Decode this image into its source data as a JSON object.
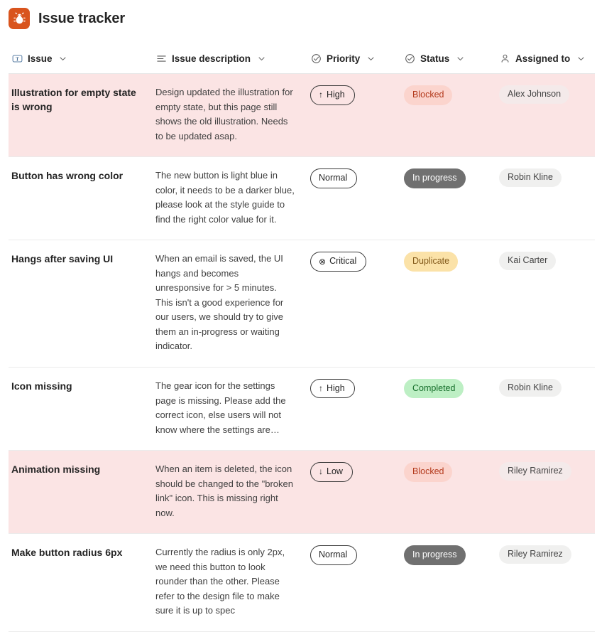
{
  "app": {
    "title": "Issue tracker",
    "logo_icon": "bug-icon",
    "logo_color": "#d9541d"
  },
  "table": {
    "columns": [
      {
        "key": "issue",
        "label": "Issue",
        "icon": "text-field-icon",
        "caret": "chevron-down-icon"
      },
      {
        "key": "description",
        "label": "Issue description",
        "icon": "multiline-text-icon",
        "caret": "chevron-down-icon"
      },
      {
        "key": "priority",
        "label": "Priority",
        "icon": "circle-check-icon",
        "caret": "chevron-down-icon"
      },
      {
        "key": "status",
        "label": "Status",
        "icon": "circle-check-icon",
        "caret": "chevron-down-icon"
      },
      {
        "key": "assigned",
        "label": "Assigned to",
        "icon": "person-icon",
        "caret": "chevron-down-icon"
      }
    ],
    "rows": [
      {
        "title": "Illustration for empty state is wrong",
        "description": "Design updated the illustration for empty state, but this page still shows the old illustration. Needs to be updated asap.",
        "priority": "High",
        "priority_icon": "↑",
        "status": "Blocked",
        "status_style": "s-blocked",
        "assigned": "Alex Johnson",
        "highlight": true
      },
      {
        "title": "Button has wrong color",
        "description": "The new button is light blue in color, it needs to be a darker blue, please look at the style guide to find the right color value for it.",
        "priority": "Normal",
        "priority_icon": "",
        "status": "In progress",
        "status_style": "s-inprogress",
        "assigned": "Robin Kline",
        "highlight": false
      },
      {
        "title": "Hangs after saving UI",
        "description": "When an email is saved, the UI hangs and becomes unresponsive for > 5 minutes. This isn't a good experience for our users, we should try to give them an in-progress or waiting indicator.",
        "priority": "Critical",
        "priority_icon": "⊗",
        "status": "Duplicate",
        "status_style": "s-duplicate",
        "assigned": "Kai Carter",
        "highlight": false
      },
      {
        "title": "Icon missing",
        "description": "The gear icon for the settings page is missing. Please add the correct icon, else users will not know where the settings are…",
        "priority": "High",
        "priority_icon": "↑",
        "status": "Completed",
        "status_style": "s-completed",
        "assigned": "Robin Kline",
        "highlight": false
      },
      {
        "title": "Animation missing",
        "description": "When an item is deleted, the icon should be changed to the \"broken link\" icon. This is missing right now.",
        "priority": "Low",
        "priority_icon": "↓",
        "status": "Blocked",
        "status_style": "s-blocked",
        "assigned": "Riley Ramirez",
        "highlight": true
      },
      {
        "title": "Make button radius 6px",
        "description": "Currently the radius is only 2px, we need this button to look rounder than the other. Please refer to the design file to make sure it is up to spec",
        "priority": "Normal",
        "priority_icon": "",
        "status": "In progress",
        "status_style": "s-inprogress",
        "assigned": "Riley Ramirez",
        "highlight": false
      }
    ]
  },
  "colors": {
    "brand": "#d9541d",
    "row_highlight": "#fbe4e4",
    "blocked": "#fbd4cd",
    "in_progress": "#707070",
    "duplicate": "#fbe2a8",
    "completed": "#bdefc4"
  }
}
